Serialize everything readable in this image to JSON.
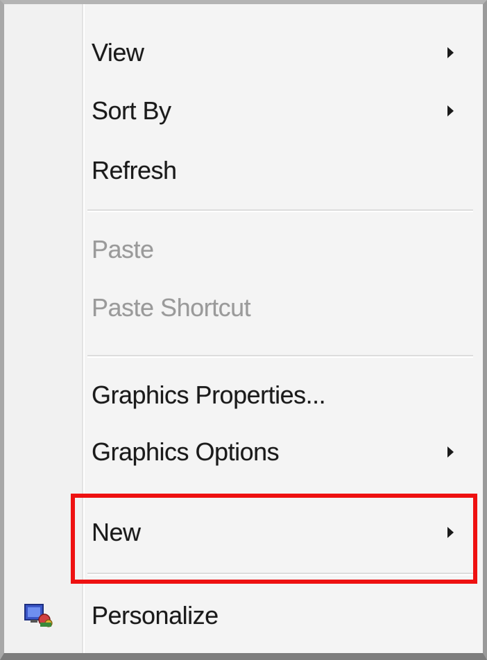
{
  "menu": {
    "items": [
      {
        "label": "View",
        "has_submenu": true,
        "enabled": true
      },
      {
        "label": "Sort By",
        "has_submenu": true,
        "enabled": true
      },
      {
        "label": "Refresh",
        "has_submenu": false,
        "enabled": true
      },
      {
        "label": "Paste",
        "has_submenu": false,
        "enabled": false
      },
      {
        "label": "Paste Shortcut",
        "has_submenu": false,
        "enabled": false
      },
      {
        "label": "Graphics Properties...",
        "has_submenu": false,
        "enabled": true
      },
      {
        "label": "Graphics Options",
        "has_submenu": true,
        "enabled": true
      },
      {
        "label": "New",
        "has_submenu": true,
        "enabled": true,
        "highlighted": true
      },
      {
        "label": "Personalize",
        "has_submenu": false,
        "enabled": true,
        "icon": "personalize-icon"
      }
    ]
  },
  "colors": {
    "highlight_outline": "#ee1111",
    "disabled_text": "#9a9a9a",
    "text": "#1a1a1a"
  }
}
